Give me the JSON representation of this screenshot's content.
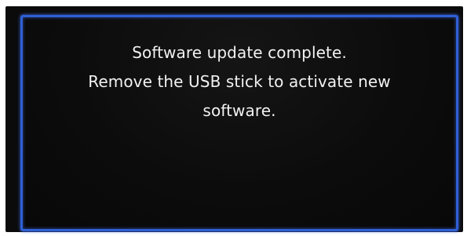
{
  "dialog": {
    "lines": [
      "Software update complete.",
      "Remove the USB stick to activate new",
      "software."
    ]
  },
  "colors": {
    "background": "#0b0b0b",
    "frame_border": "#2f5fd4",
    "text": "#f2f2f2"
  }
}
